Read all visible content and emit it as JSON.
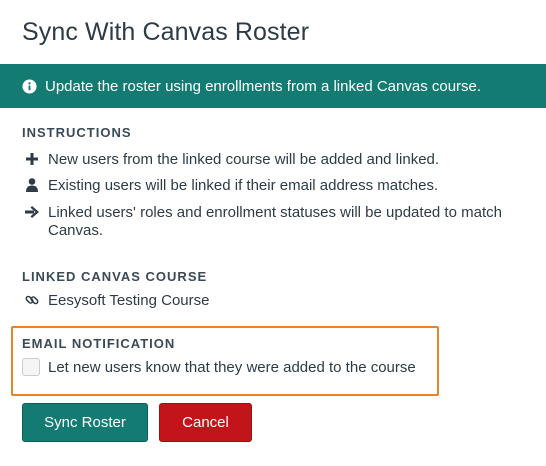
{
  "dialog": {
    "title": "Sync With Canvas Roster"
  },
  "banner": {
    "icon": "info-circle-icon",
    "text": "Update the roster using enrollments from a linked Canvas course.",
    "color": "#147b73"
  },
  "instructions": {
    "heading": "INSTRUCTIONS",
    "items": [
      {
        "icon": "plus-icon",
        "text": "New users from the linked course will be added and linked."
      },
      {
        "icon": "user-icon",
        "text": "Existing users will be linked if their email address matches."
      },
      {
        "icon": "arrow-right-icon",
        "text": "Linked users' roles and enrollment statuses will be updated to match Canvas."
      }
    ]
  },
  "linked_course": {
    "heading": "LINKED CANVAS COURSE",
    "icon": "link-icon",
    "name": "Eesysoft Testing Course"
  },
  "email_notification": {
    "heading": "EMAIL NOTIFICATION",
    "checkbox_label": "Let new users know that they were added to the course",
    "checked": false,
    "highlight_color": "#e8832a"
  },
  "buttons": {
    "sync_label": "Sync Roster",
    "cancel_label": "Cancel",
    "sync_color": "#147b73",
    "cancel_color": "#c4141b"
  }
}
